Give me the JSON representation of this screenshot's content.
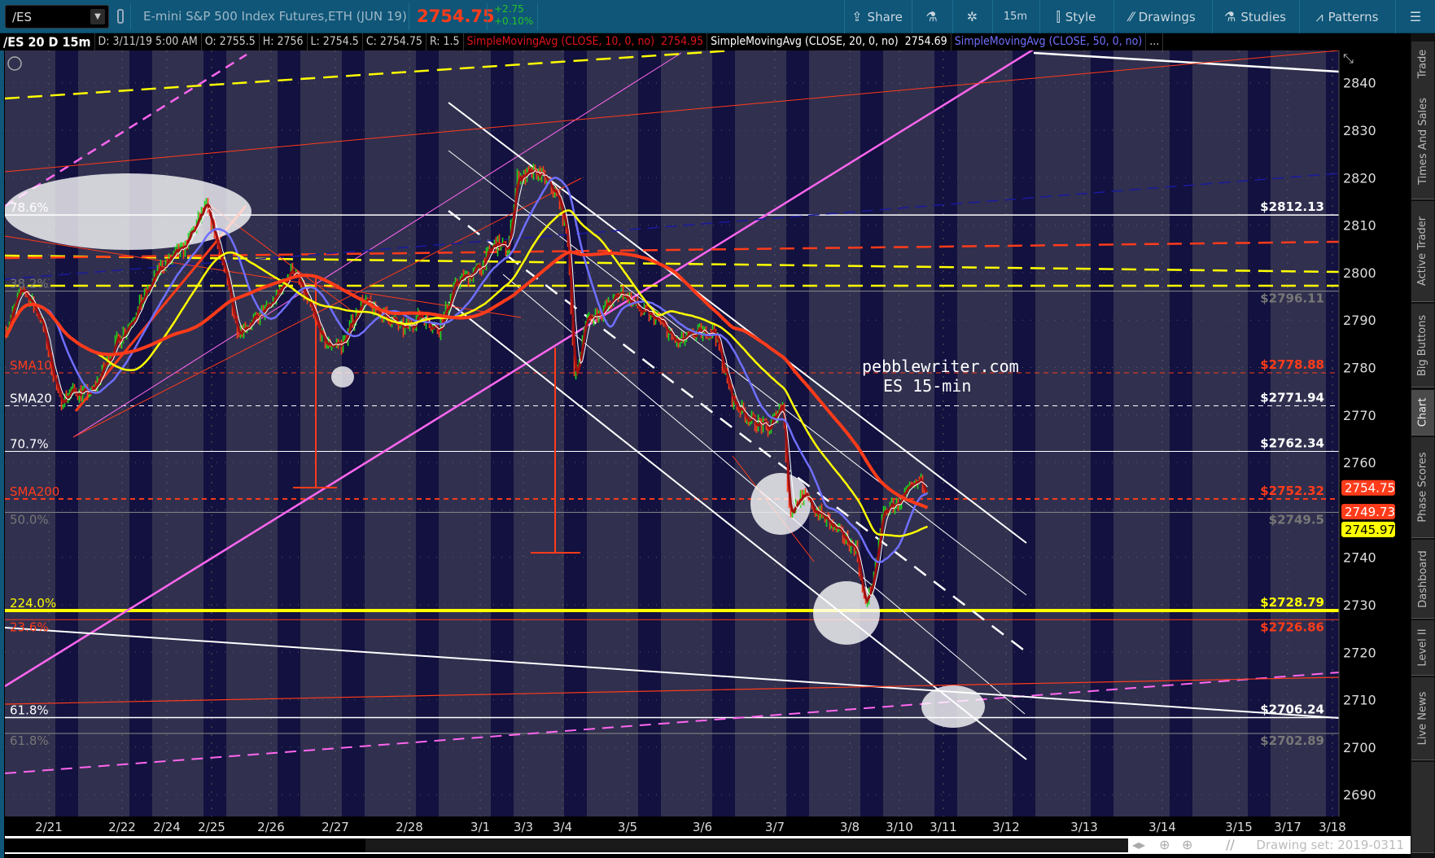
{
  "toolbar": {
    "symbol": "/ES",
    "instrument": "E-mini S&P 500 Index Futures,ETH (JUN 19)",
    "last": "2754.75",
    "change": "+2.75",
    "change_pct": "+0.10%",
    "buttons": [
      {
        "label": "Share",
        "icon": "share-icon"
      },
      {
        "label": "",
        "icon": "flask-icon"
      },
      {
        "label": "",
        "icon": "gear-icon"
      },
      {
        "label": "15m",
        "icon": ""
      },
      {
        "label": "Style",
        "icon": "candlestick-icon"
      },
      {
        "label": "Drawings",
        "icon": "drawings-icon"
      },
      {
        "label": "Studies",
        "icon": "flask-icon"
      },
      {
        "label": "Patterns",
        "icon": "patterns-icon"
      },
      {
        "label": "",
        "icon": "menu-icon"
      }
    ]
  },
  "infobar": {
    "chart": "/ES 20 D 15m",
    "date": "D: 3/11/19 5:00 AM",
    "open": "O: 2755.5",
    "high": "H: 2756",
    "low": "L: 2754.5",
    "close": "C: 2754.75",
    "range": "R: 1.5",
    "sma10_label": "SimpleMovingAvg (CLOSE, 10, 0, no)",
    "sma10_value": "2754.95",
    "sma20_label": "SimpleMovingAvg (CLOSE, 20, 0, no)",
    "sma20_value": "2754.69",
    "sma50_label": "SimpleMovingAvg (CLOSE, 50, 0, no)",
    "more": "...",
    "colors": {
      "sma10": "#e0141c",
      "sma20": "#ffffff",
      "sma50": "#6f6fff"
    }
  },
  "sidebar": {
    "tabs": [
      "Trade",
      "Times And Sales",
      "Active Trader",
      "Big Buttons",
      "Chart",
      "Phase Scores",
      "Dashboard",
      "Level II",
      "Live News"
    ],
    "selected": "Chart"
  },
  "footer": {
    "drawing_set": "Drawing set: 2019-0311"
  },
  "chart_data": {
    "type": "candlestick",
    "symbol": "/ES",
    "interval": "15m",
    "ylim": [
      2685,
      2848
    ],
    "y_ticks": [
      2840,
      2830,
      2820,
      2810,
      2800,
      2790,
      2780,
      2770,
      2760,
      2750,
      2740,
      2730,
      2720,
      2710,
      2700,
      2690
    ],
    "x_ticks": [
      "2/21",
      "2/22",
      "2/24",
      "2/25",
      "2/26",
      "2/27",
      "2/28",
      "3/1",
      "3/3",
      "3/4",
      "3/5",
      "3/6",
      "3/7",
      "3/8",
      "3/10",
      "3/11",
      "3/12",
      "3/13",
      "3/14",
      "3/15",
      "3/17",
      "3/18"
    ],
    "grid": true,
    "price_path": [
      [
        "2/20 10:00",
        2788
      ],
      [
        "2/20 15:30",
        2797
      ],
      [
        "2/20 21:30",
        2790
      ],
      [
        "2/21 03:30",
        2773
      ],
      [
        "2/21 08:00",
        2775
      ],
      [
        "2/21 14:00",
        2774.5
      ],
      [
        "2/21 21:00",
        2784
      ],
      [
        "2/22 08:00",
        2792
      ],
      [
        "2/22 20:30",
        2801
      ],
      [
        "2/24 09:00",
        2805
      ],
      [
        "2/24 21:00",
        2814
      ],
      [
        "2/25 03:00",
        2805
      ],
      [
        "2/25 10:30",
        2788
      ],
      [
        "2/25 18:00",
        2790
      ],
      [
        "2/26 01:00",
        2794
      ],
      [
        "2/26 08:00",
        2801
      ],
      [
        "2/26 15:00",
        2792
      ],
      [
        "2/26 20:00",
        2785
      ],
      [
        "2/27 02:30",
        2785
      ],
      [
        "2/27 08:30",
        2794
      ],
      [
        "2/27 16:00",
        2791
      ],
      [
        "2/27 22:00",
        2788
      ],
      [
        "2/28 04:00",
        2791
      ],
      [
        "2/28 10:00",
        2788
      ],
      [
        "2/28 16:00",
        2798
      ],
      [
        "3/1 00:00",
        2801
      ],
      [
        "3/1 08:00",
        2806
      ],
      [
        "3/1 15:30",
        2805
      ],
      [
        "3/1 20:30",
        2820
      ],
      [
        "3/3 10:00",
        2821
      ],
      [
        "3/3 21:30",
        2816
      ],
      [
        "3/4 02:00",
        2807
      ],
      [
        "3/4 04:30",
        2776
      ],
      [
        "3/4 08:30",
        2790
      ],
      [
        "3/4 15:00",
        2792
      ],
      [
        "3/4 22:00",
        2796
      ],
      [
        "3/5 04:00",
        2792
      ],
      [
        "3/5 10:00",
        2790
      ],
      [
        "3/5 16:00",
        2785
      ],
      [
        "3/5 21:30",
        2787
      ],
      [
        "3/6 04:00",
        2788
      ],
      [
        "3/6 07:00",
        2780
      ],
      [
        "3/6 10:00",
        2773
      ],
      [
        "3/6 16:00",
        2769
      ],
      [
        "3/6 22:00",
        2767
      ],
      [
        "3/7 02:30",
        2773
      ],
      [
        "3/7 04:30",
        2749.5
      ],
      [
        "3/7 08:30",
        2753
      ],
      [
        "3/7 14:00",
        2749.5
      ],
      [
        "3/7 20:00",
        2745.5
      ],
      [
        "3/8 03:00",
        2742
      ],
      [
        "3/8 07:00",
        2730
      ],
      [
        "3/8 11:30",
        2735
      ],
      [
        "3/8 16:00",
        2749.5
      ],
      [
        "3/10 01:00",
        2752
      ],
      [
        "3/10 11:00",
        2756
      ],
      [
        "3/10 16:00",
        2754.75
      ]
    ],
    "levels": [
      {
        "price": 2812.13,
        "right": "$2812.13",
        "left": "78.6%",
        "color": "#ffffff",
        "label_color": "#ffffff",
        "style": "solid",
        "w": 1.5
      },
      {
        "price": 2796.11,
        "right": "$2796.11",
        "left": "38.2%",
        "color": "#8a8a8a",
        "label_color": "#777777",
        "style": "solid",
        "w": 1
      },
      {
        "price": 2778.88,
        "right": "$2778.88",
        "left": "SMA10",
        "color": "#ff3b1a",
        "label_color": "#ff3b1a",
        "style": "dash",
        "w": 1
      },
      {
        "price": 2771.94,
        "right": "$2771.94",
        "left": "SMA20",
        "color": "#ffffff",
        "label_color": "#ffffff",
        "style": "dash",
        "w": 1
      },
      {
        "price": 2762.34,
        "right": "$2762.34",
        "left": "70.7%",
        "color": "#ffffff",
        "label_color": "#ffffff",
        "style": "solid",
        "w": 1
      },
      {
        "price": 2752.32,
        "right": "$2752.32",
        "left": "SMA200",
        "color": "#ff3b1a",
        "label_color": "#ff3b1a",
        "style": "dash",
        "w": 2
      },
      {
        "price": 2749.5,
        "right": "$2749.5",
        "left": "50.0%",
        "color": "#8a8a8a",
        "label_color": "#777777",
        "style": "solid",
        "w": 1
      },
      {
        "price": 2728.79,
        "right": "$2728.79",
        "left": "224.0%",
        "color": "#ffff00",
        "label_color": "#ffff00",
        "style": "solid",
        "w": 4
      },
      {
        "price": 2726.86,
        "right": "$2726.86",
        "left": "23.6%",
        "color": "#ff3b1a",
        "label_color": "#ff3b1a",
        "style": "solid",
        "w": 1
      },
      {
        "price": 2706.24,
        "right": "$2706.24",
        "left": "61.8%",
        "color": "#ffffff",
        "label_color": "#ffffff",
        "style": "solid",
        "w": 1.5
      },
      {
        "price": 2702.89,
        "right": "$2702.89",
        "left": "61.8%",
        "color": "#8a8a8a",
        "label_color": "#777777",
        "style": "solid",
        "w": 1
      }
    ],
    "price_badges": [
      {
        "value": "2754.75",
        "price": 2754.75,
        "bg": "#ff3b1a",
        "fg": "#ffffff"
      },
      {
        "value": "2749.73",
        "price": 2749.73,
        "bg": "#ff3b1a",
        "fg": "#ffffff"
      },
      {
        "value": "2745.97",
        "price": 2745.97,
        "bg": "#ffff00",
        "fg": "#000000"
      }
    ],
    "watermark": [
      "pebblewriter.com",
      "ES 15-min"
    ],
    "colors": {
      "up": "#1fd31f",
      "down": "#ff3b1a",
      "bg_day": "#31304f",
      "bg_night": "#12113f",
      "sma_fast": "#ffffff",
      "sma_dark": "#a01010",
      "sma_mid": "#6f6fff",
      "sma_slow": "#ffff00",
      "sma_long": "#ff3b1a"
    }
  }
}
